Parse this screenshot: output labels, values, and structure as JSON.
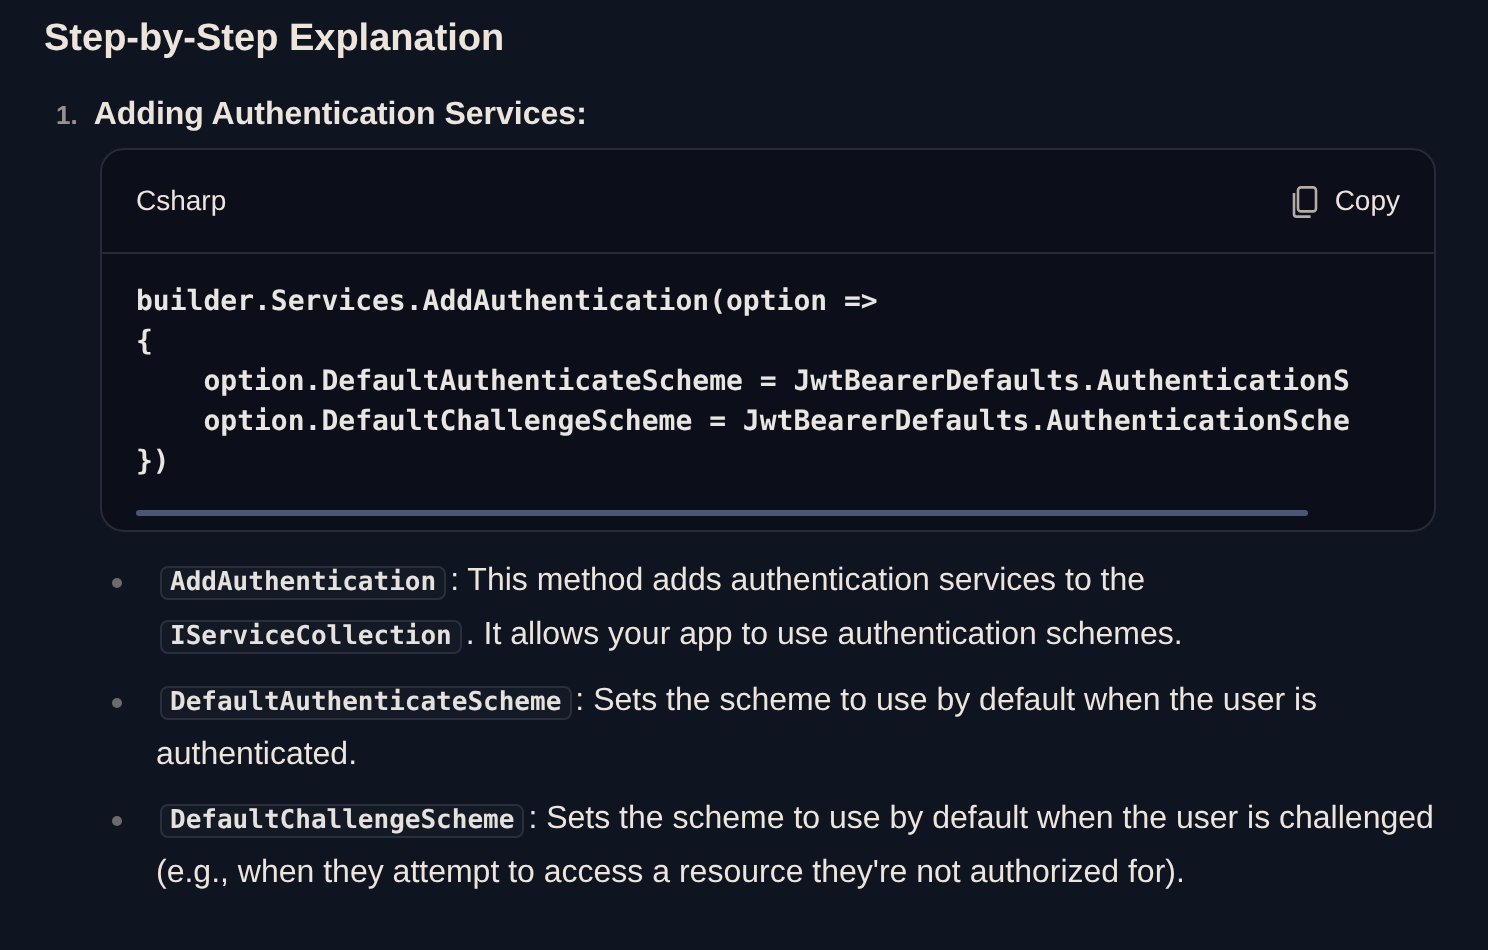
{
  "heading": "Step-by-Step Explanation",
  "steps": [
    {
      "number": "1.",
      "title": "Adding Authentication Services:",
      "code_block": {
        "language": "Csharp",
        "copy_label": "Copy",
        "lines": [
          "builder.Services.AddAuthentication(option =>",
          "{",
          "    option.DefaultAuthenticateScheme = JwtBearerDefaults.AuthenticationS",
          "    option.DefaultChallengeScheme = JwtBearerDefaults.AuthenticationSche",
          "})"
        ]
      },
      "bullets": [
        {
          "parts": [
            {
              "kind": "code",
              "text": "AddAuthentication"
            },
            {
              "kind": "text",
              "text": ": This method adds authentication services to the"
            },
            {
              "kind": "code",
              "text": "IServiceCollection"
            },
            {
              "kind": "text",
              "text": ". It allows your app to use authentication schemes."
            }
          ]
        },
        {
          "parts": [
            {
              "kind": "code",
              "text": "DefaultAuthenticateScheme"
            },
            {
              "kind": "text",
              "text": ": Sets the scheme to use by default when the user is authenticated."
            }
          ]
        },
        {
          "parts": [
            {
              "kind": "code",
              "text": "DefaultChallengeScheme"
            },
            {
              "kind": "text",
              "text": ": Sets the scheme to use by default when the user is challenged (e.g., when they attempt to access a resource they're not authorized for)."
            }
          ]
        }
      ]
    }
  ]
}
